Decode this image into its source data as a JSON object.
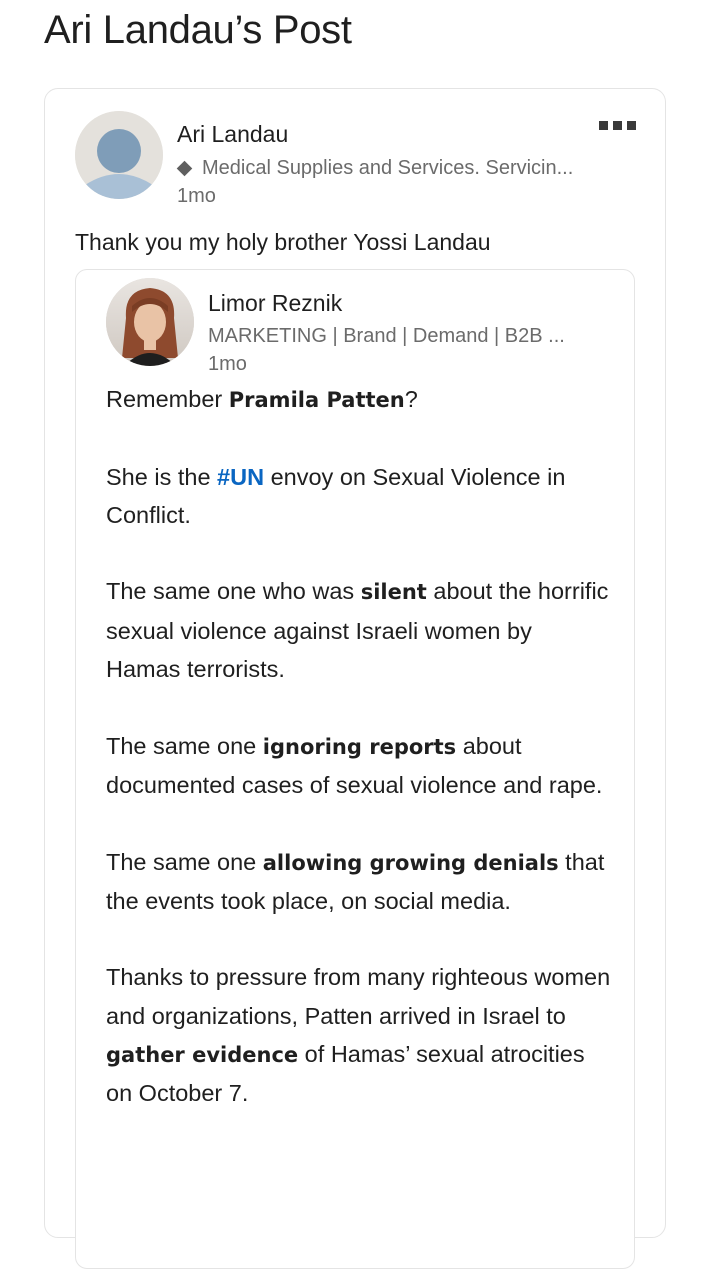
{
  "page": {
    "title": "Ari Landau’s Post"
  },
  "post": {
    "author": {
      "name": "Ari Landau",
      "headline": "Medical Supplies and Services. Servicin...",
      "time": "1mo"
    },
    "text": "Thank you my holy brother Yossi Landau",
    "more_icon": "more-horizontal-icon"
  },
  "shared": {
    "author": {
      "name": "Limor Reznik",
      "headline": "MARKETING | Brand | Demand | B2B ...",
      "time": "1mo"
    },
    "p1": {
      "a": "Remember ",
      "b": "Pramila Patten",
      "c": "?"
    },
    "p2": {
      "a": "She is the ",
      "tag": "#UN",
      "c": " envoy on Sexual Violence in Conflict."
    },
    "p3": {
      "a": "The same one who was ",
      "b": "silent",
      "c": " about the horrific sexual violence against Israeli women by Hamas terrorists."
    },
    "p4": {
      "a": "The same one ",
      "b": "ignoring reports",
      "c": " about documented cases of sexual violence and rape."
    },
    "p5": {
      "a": "The same one ",
      "b": "allowing growing denials",
      "c": " that the events took place, on social media."
    },
    "p6": {
      "a": "Thanks to pressure from many righteous women and organizations, Patten arrived in Israel to ",
      "b": "gather evidence",
      "c": " of Hamas’ sexual atrocities on October 7."
    }
  },
  "colors": {
    "hashtag": "#0a66c2",
    "secondary_text": "#6b6b6b"
  }
}
